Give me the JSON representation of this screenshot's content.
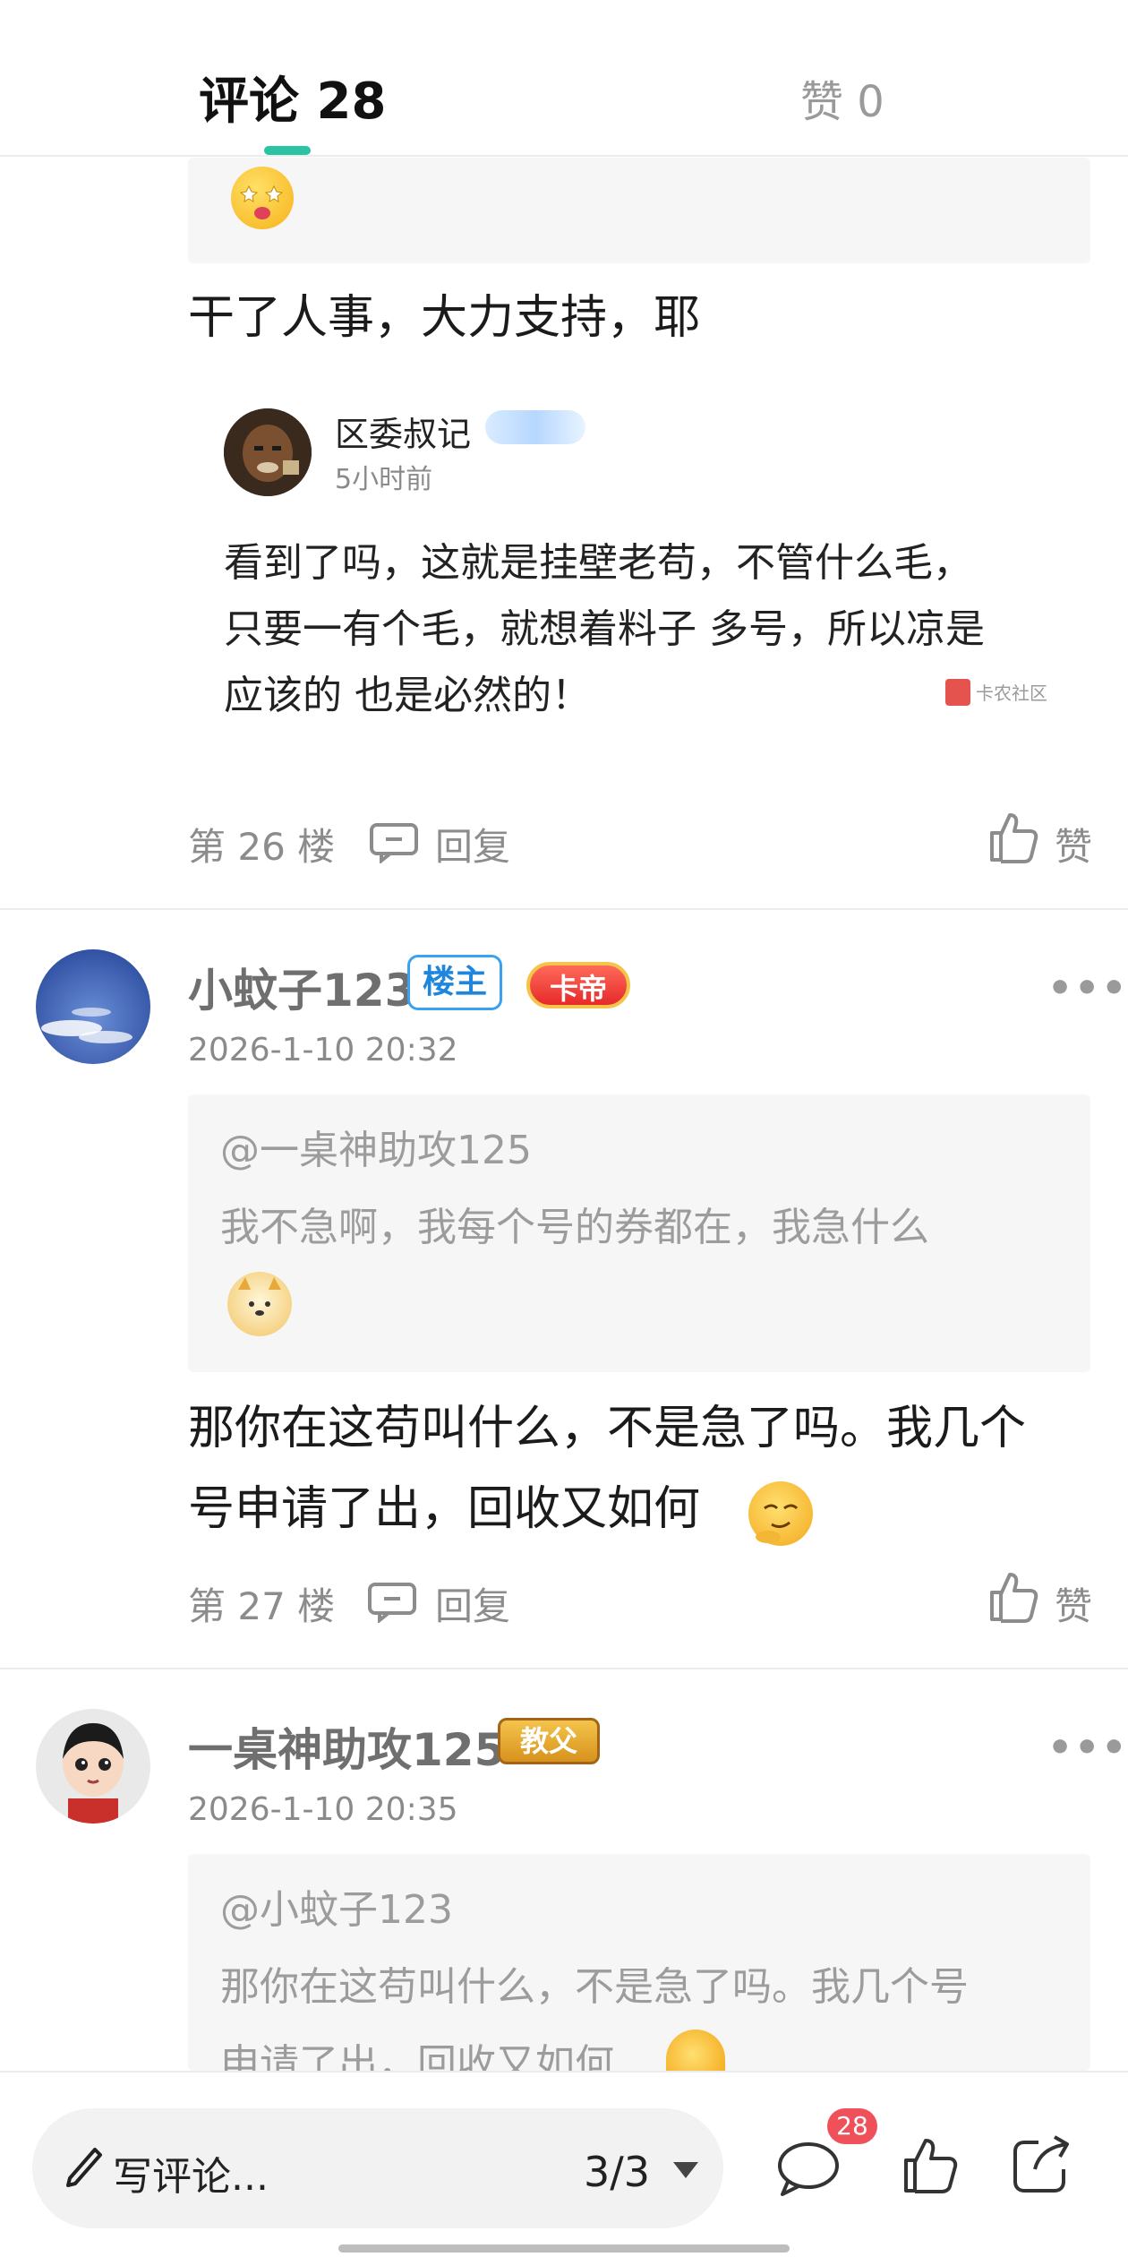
{
  "tabs": {
    "comments": "评论 28",
    "likes": "赞 0"
  },
  "floor26": {
    "body": "干了人事，大力支持，耶",
    "reply": {
      "user": "区委叔记",
      "time": "5小时前",
      "text_lines": [
        "看到了吗，这就是挂壁老苟，不管什么毛，",
        "只要一有个毛，就想着料子 多号，所以凉是",
        "应该的 也是必然的！"
      ],
      "watermark": "卡农社区"
    },
    "floor_label": "第 26 楼",
    "reply_label": "回复",
    "like_label": "赞"
  },
  "floor27": {
    "user": "小蚊子123",
    "owner_badge": "楼主",
    "rank_badge": "卡帝",
    "time": "2026-1-10 20:32",
    "quote_at": "@一桌神助攻125",
    "quote_text": "我不急啊，我每个号的券都在，我急什么",
    "body_lines": [
      "那你在这苟叫什么，不是急了吗。我几个",
      "号申请了出，回收又如何"
    ],
    "floor_label": "第 27 楼",
    "reply_label": "回复",
    "like_label": "赞"
  },
  "floor28": {
    "user": "一桌神助攻125",
    "rank_badge": "教父",
    "time": "2026-1-10 20:35",
    "quote_at": "@小蚊子123",
    "quote_lines": [
      "那你在这苟叫什么，不是急了吗。我几个号",
      "申请了出，回收又如何"
    ]
  },
  "bottom": {
    "write_comment": "写评论...",
    "page_indicator": "3/3",
    "comment_count": "28"
  },
  "colors": {
    "accent": "#2cc3a4",
    "badge": "#f0505a"
  }
}
